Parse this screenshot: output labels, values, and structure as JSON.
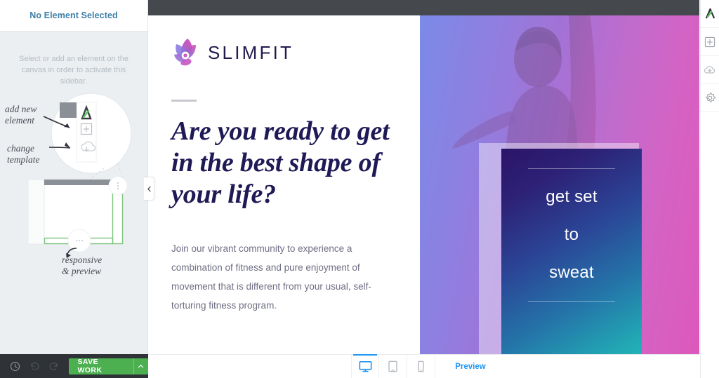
{
  "sidebar": {
    "title": "No Element Selected",
    "hint": "Select or add an element on the canvas in order to activate this sidebar.",
    "sketch": {
      "label_add": "add new",
      "label_add2": "element",
      "label_change": "change",
      "label_change2": "template",
      "label_responsive": "responsive",
      "label_responsive2": "& preview"
    }
  },
  "bottom_left_toolbar": {
    "history_icon": "clock-icon",
    "undo_icon": "undo-icon",
    "redo_icon": "redo-icon",
    "save_label": "SAVE WORK",
    "save_caret_icon": "chevron-up-icon",
    "save_color": "#4cb050"
  },
  "bottom_bar": {
    "devices": [
      {
        "name": "desktop",
        "icon": "monitor-icon",
        "active": true
      },
      {
        "name": "tablet",
        "icon": "tablet-icon",
        "active": false
      },
      {
        "name": "mobile",
        "icon": "phone-icon",
        "active": false
      }
    ],
    "preview_label": "Preview",
    "accent_color": "#2196f3"
  },
  "right_rail": {
    "items": [
      {
        "icon": "app-logo-icon",
        "label": "App logo"
      },
      {
        "icon": "plus-square-icon",
        "label": "Add element"
      },
      {
        "icon": "cloud-download-icon",
        "label": "Change template"
      },
      {
        "icon": "gear-icon",
        "label": "Settings"
      }
    ]
  },
  "canvas": {
    "topbar_color": "#45494d",
    "collapse_icon": "chevron-left-icon",
    "scrollbar": {
      "up_icon": "chevron-up-icon",
      "down_icon": "chevron-down-icon"
    }
  },
  "page": {
    "logo": {
      "text": "SLIMFIT",
      "mark": "flower-petal-logo-icon",
      "text_color": "#221b4e"
    },
    "headline": "Are you ready to get in the best shape of your life?",
    "paragraph": "Join our vibrant community to experience a combination of fitness and pure enjoyment of movement that is different from your usual, self-torturing fitness program.",
    "hero": {
      "photo_alt": "person-with-raised-arms-photo",
      "gradient_from": "#7b8ae8",
      "gradient_to": "#dd58bb",
      "card": {
        "line1": "get set",
        "line2": "to",
        "line3": "sweat",
        "gradient_from": "#2b1469",
        "gradient_to": "#25bcb9"
      }
    }
  }
}
